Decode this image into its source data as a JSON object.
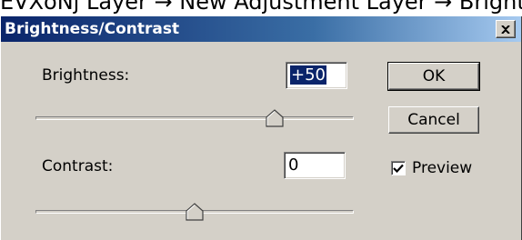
{
  "menu_path": "EVXoNj Layer → New Adjustment Layer → Brightness/Contrast",
  "dialog": {
    "title": "Brightness/Contrast",
    "brightness": {
      "label": "Brightness:",
      "value": "+50",
      "slider_value": 50,
      "slider_range": [
        -100,
        100
      ]
    },
    "contrast": {
      "label": "Contrast:",
      "value": "0",
      "slider_value": 0,
      "slider_range": [
        -100,
        100
      ]
    },
    "ok_label": "OK",
    "cancel_label": "Cancel",
    "preview_label": "Preview",
    "preview_checked": true
  },
  "icons": {
    "close": "close-icon",
    "check": "check-icon",
    "thumb": "slider-thumb-icon"
  },
  "colors": {
    "face": "#d4d0c8",
    "title_start": "#0a246a",
    "title_end": "#a6caf0",
    "selection": "#0a246a"
  }
}
